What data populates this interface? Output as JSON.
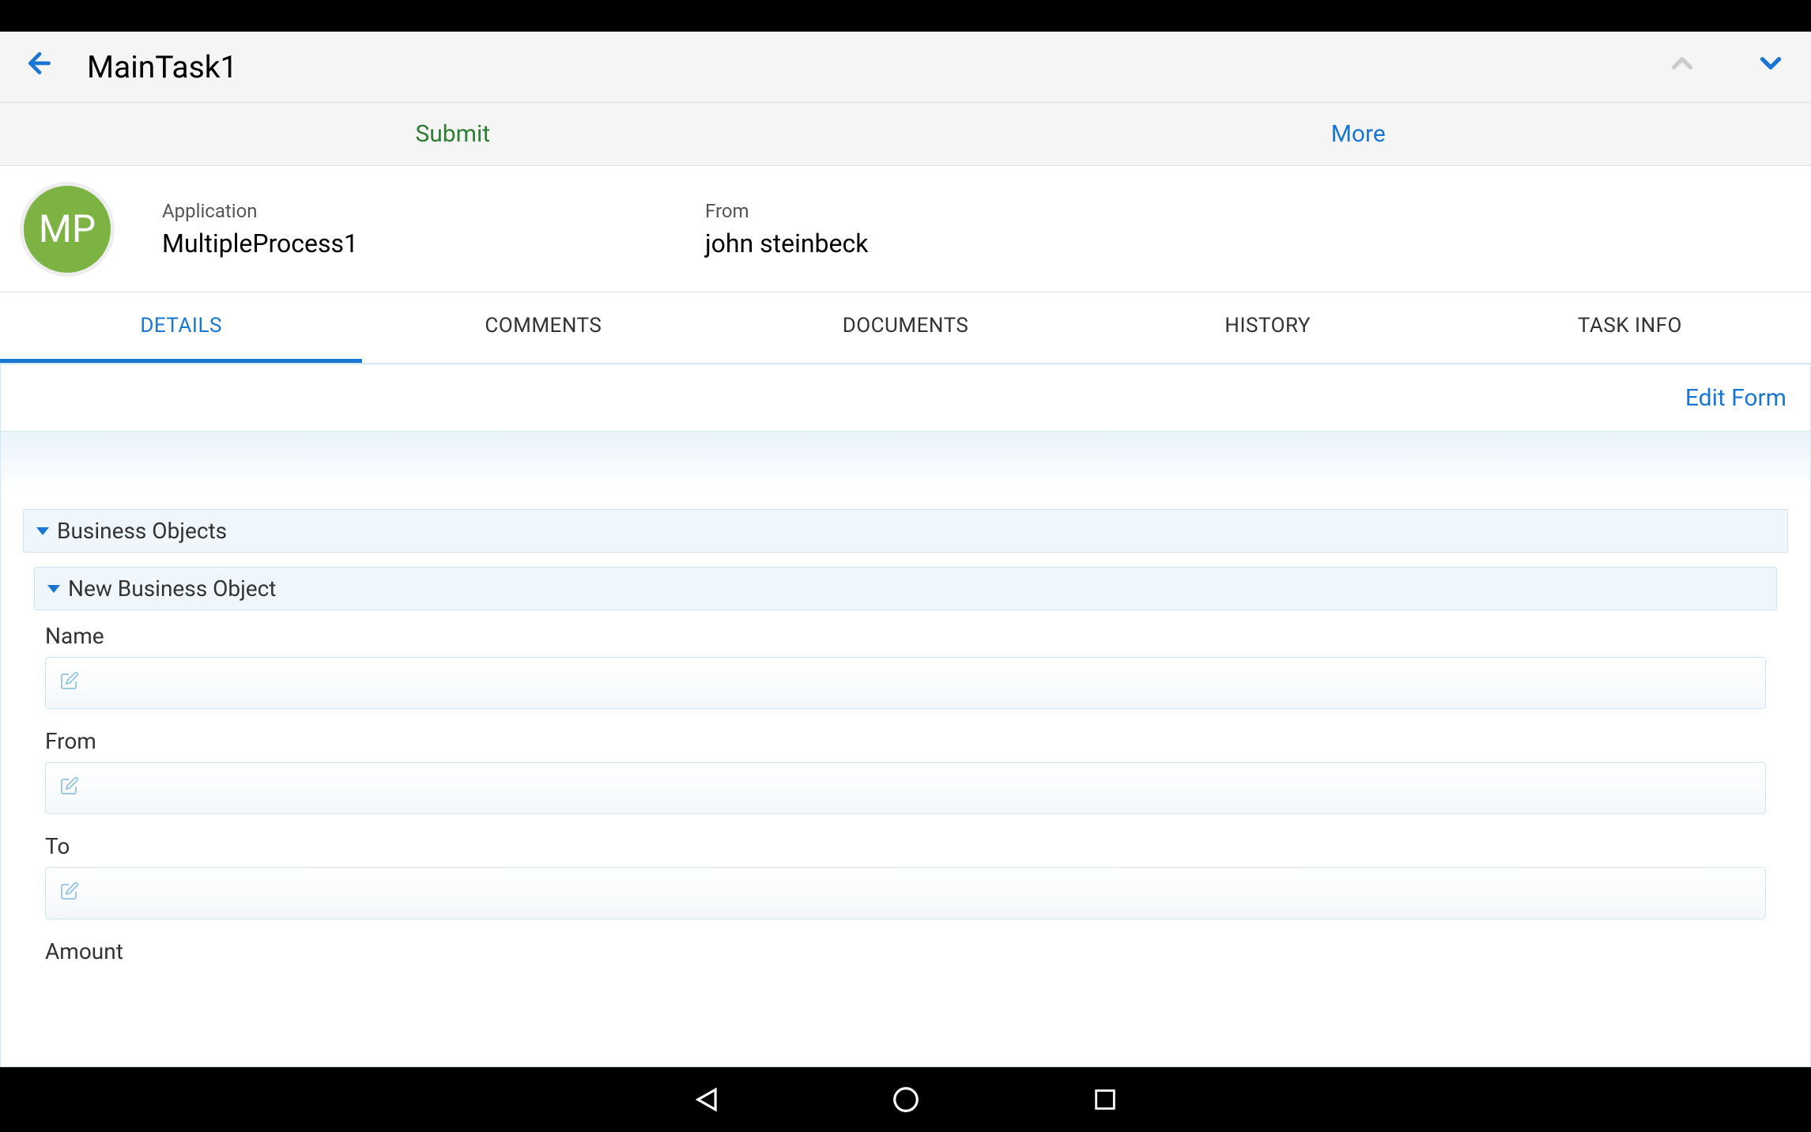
{
  "header": {
    "title": "MainTask1"
  },
  "actions": {
    "submit": "Submit",
    "more": "More"
  },
  "summary": {
    "avatar_initials": "MP",
    "application_label": "Application",
    "application_value": "MultipleProcess1",
    "from_label": "From",
    "from_value": "john steinbeck"
  },
  "tabs": {
    "details": "DETAILS",
    "comments": "COMMENTS",
    "documents": "DOCUMENTS",
    "history": "HISTORY",
    "taskinfo": "TASK INFO"
  },
  "form": {
    "edit_link": "Edit Form",
    "section1_title": "Business Objects",
    "subsection1_title": "New Business Object",
    "fields": {
      "name_label": "Name",
      "name_value": "",
      "from_label": "From",
      "from_value": "",
      "to_label": "To",
      "to_value": "",
      "amount_label": "Amount"
    }
  }
}
